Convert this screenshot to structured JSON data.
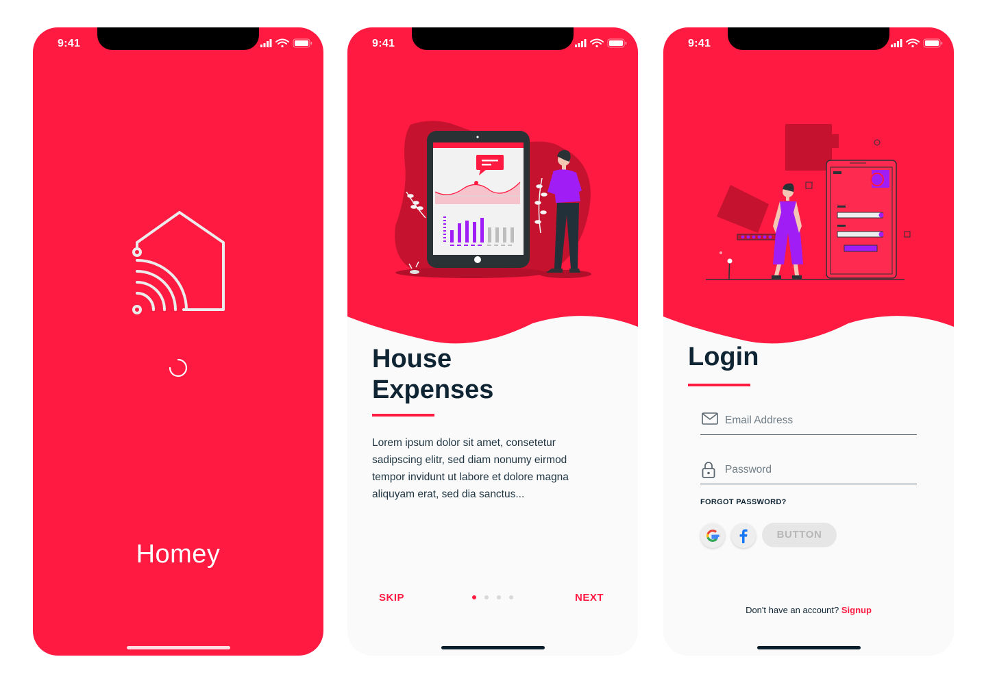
{
  "status_bar": {
    "time": "9:41"
  },
  "splash": {
    "app_name": "Homey"
  },
  "onboarding": {
    "title_line1": "House",
    "title_line2": "Expenses",
    "body": "Lorem ipsum dolor sit amet, consetetur sadipscing elitr, sed diam nonumy eirmod tempor invidunt ut labore et dolore magna aliquyam erat, sed dia sanctus...",
    "skip_label": "SKIP",
    "next_label": "NEXT",
    "page_count": 4,
    "current_page": 1
  },
  "login": {
    "title": "Login",
    "email_placeholder": "Email Address",
    "password_placeholder": "Password",
    "forgot_label": "FORGOT PASSWORD?",
    "button_label": "BUTTON",
    "no_account_text": "Don't have an account?",
    "signup_label": "Signup"
  },
  "colors": {
    "accent": "#ff1a42",
    "text_dark": "#0f2533",
    "purple": "#a11df5"
  },
  "icons": [
    "signal-icon",
    "wifi-icon",
    "battery-icon",
    "home-wifi-logo-icon",
    "spinner-icon",
    "mail-icon",
    "lock-icon",
    "google-icon",
    "facebook-icon"
  ]
}
